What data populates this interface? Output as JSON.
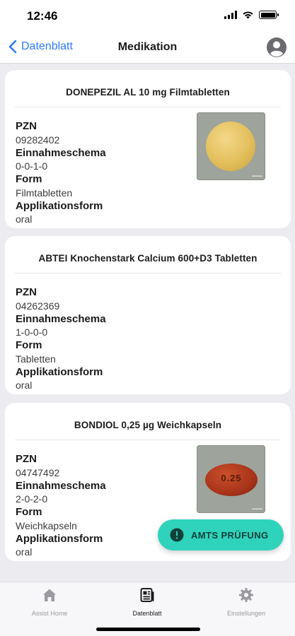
{
  "status_bar": {
    "time": "12:46"
  },
  "nav": {
    "back_label": "Datenblatt",
    "title": "Medikation"
  },
  "medications": [
    {
      "title": "DONEPEZIL AL 10 mg Filmtabletten",
      "pzn_label": "PZN",
      "pzn": "09282402",
      "schema_label": "Einnahmeschema",
      "schema": "0-0-1-0",
      "form_label": "Form",
      "form": "Filmtabletten",
      "route_label": "Applikationsform",
      "route": "oral"
    },
    {
      "title": "ABTEI Knochenstark Calcium 600+D3 Tabletten",
      "pzn_label": "PZN",
      "pzn": "04262369",
      "schema_label": "Einnahmeschema",
      "schema": "1-0-0-0",
      "form_label": "Form",
      "form": "Tabletten",
      "route_label": "Applikationsform",
      "route": "oral"
    },
    {
      "title": "BONDIOL 0,25 µg Weichkapseln",
      "pzn_label": "PZN",
      "pzn": "04747492",
      "schema_label": "Einnahmeschema",
      "schema": "2-0-2-0",
      "form_label": "Form",
      "form": "Weichkapseln",
      "route_label": "Applikationsform",
      "route": "oral",
      "pill_imprint": "0.25"
    }
  ],
  "amts_button": {
    "label": "AMTS PRÜFUNG",
    "icon": "alert-circle-icon",
    "color": "#2fd3bc"
  },
  "tab_bar": {
    "items": [
      {
        "label": "Assist Home",
        "icon": "home-icon"
      },
      {
        "label": "Datenblatt",
        "icon": "document-icon",
        "active": true
      },
      {
        "label": "Einstellungen",
        "icon": "gear-icon"
      }
    ]
  },
  "colors": {
    "accent": "#2f7cf6",
    "background": "#ececf0"
  }
}
